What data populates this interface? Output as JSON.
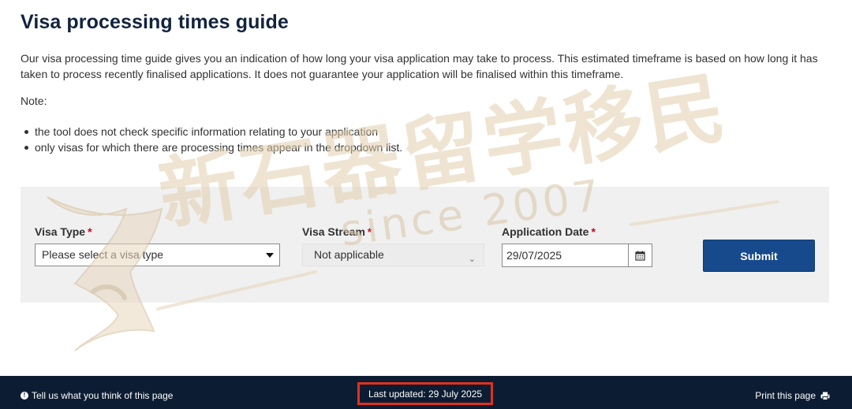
{
  "page": {
    "title": "Visa processing times guide",
    "intro": "Our visa processing time guide gives you an indication of how long your visa application may take to process. This estimated timeframe is based on how long it has taken to process recently finalised applications. It does not guarantee your application will be finalised within this timeframe.",
    "note_label": "Note:",
    "notes": [
      "the tool does not check specific information relating to your application",
      "only visas for which there are processing times appear in the dropdown list."
    ]
  },
  "form": {
    "visa_type": {
      "label": "Visa Type",
      "required_mark": "*",
      "value": "Please select a visa type"
    },
    "visa_stream": {
      "label": "Visa Stream",
      "required_mark": "*",
      "value": "Not applicable"
    },
    "application_date": {
      "label": "Application Date",
      "required_mark": "*",
      "value": "29/07/2025"
    },
    "submit_label": "Submit"
  },
  "footer": {
    "feedback_label": "Tell us what you think of this page",
    "last_updated": "Last updated: 29 July 2025",
    "print_label": "Print this page"
  },
  "watermark": {
    "text": "新石器留学移民",
    "since": "since 2007"
  },
  "colors": {
    "title": "#12233f",
    "submit_button": "#174a8c",
    "footer_bg": "#0c1d33",
    "highlight_box": "#e0301e",
    "required": "#d0021b",
    "panel_bg": "#f0f0f0"
  },
  "icons": {
    "feedback": "info-circle-icon",
    "print": "printer-icon",
    "calendar": "calendar-icon",
    "visa_type_dropdown": "caret-down-icon",
    "visa_stream_dropdown": "chevron-down-icon"
  }
}
